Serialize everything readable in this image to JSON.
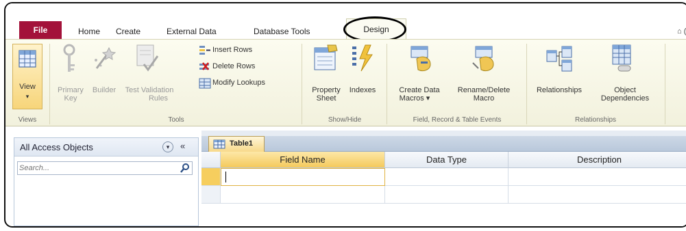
{
  "tabs": {
    "file": "File",
    "home": "Home",
    "create": "Create",
    "external_data": "External Data",
    "database_tools": "Database Tools",
    "design": "Design"
  },
  "help_glyph": "⌂ (",
  "ribbon": {
    "view": {
      "label": "View",
      "arrow": "▾",
      "group": "Views"
    },
    "tools": {
      "primary_key": [
        "Primary",
        "Key"
      ],
      "builder": "Builder",
      "test_validation": [
        "Test Validation",
        "Rules"
      ],
      "insert_rows": "Insert Rows",
      "delete_rows": "Delete Rows",
      "modify_lookups": "Modify Lookups",
      "group": "Tools"
    },
    "show_hide": {
      "property_sheet": [
        "Property",
        "Sheet"
      ],
      "indexes": "Indexes",
      "group": "Show/Hide"
    },
    "events": {
      "create_data_macros": [
        "Create Data",
        "Macros ▾"
      ],
      "rename_delete_macro": [
        "Rename/Delete",
        "Macro"
      ],
      "group": "Field, Record & Table Events"
    },
    "relationships": {
      "relationships": "Relationships",
      "object_dependencies": [
        "Object",
        "Dependencies"
      ],
      "group": "Relationships"
    }
  },
  "nav": {
    "title": "All Access Objects",
    "dropdown_glyph": "▾",
    "collapse_glyph": "«",
    "search_placeholder": "Search..."
  },
  "document": {
    "tab_label": "Table1",
    "columns": [
      "Field Name",
      "Data Type",
      "Description"
    ]
  }
}
